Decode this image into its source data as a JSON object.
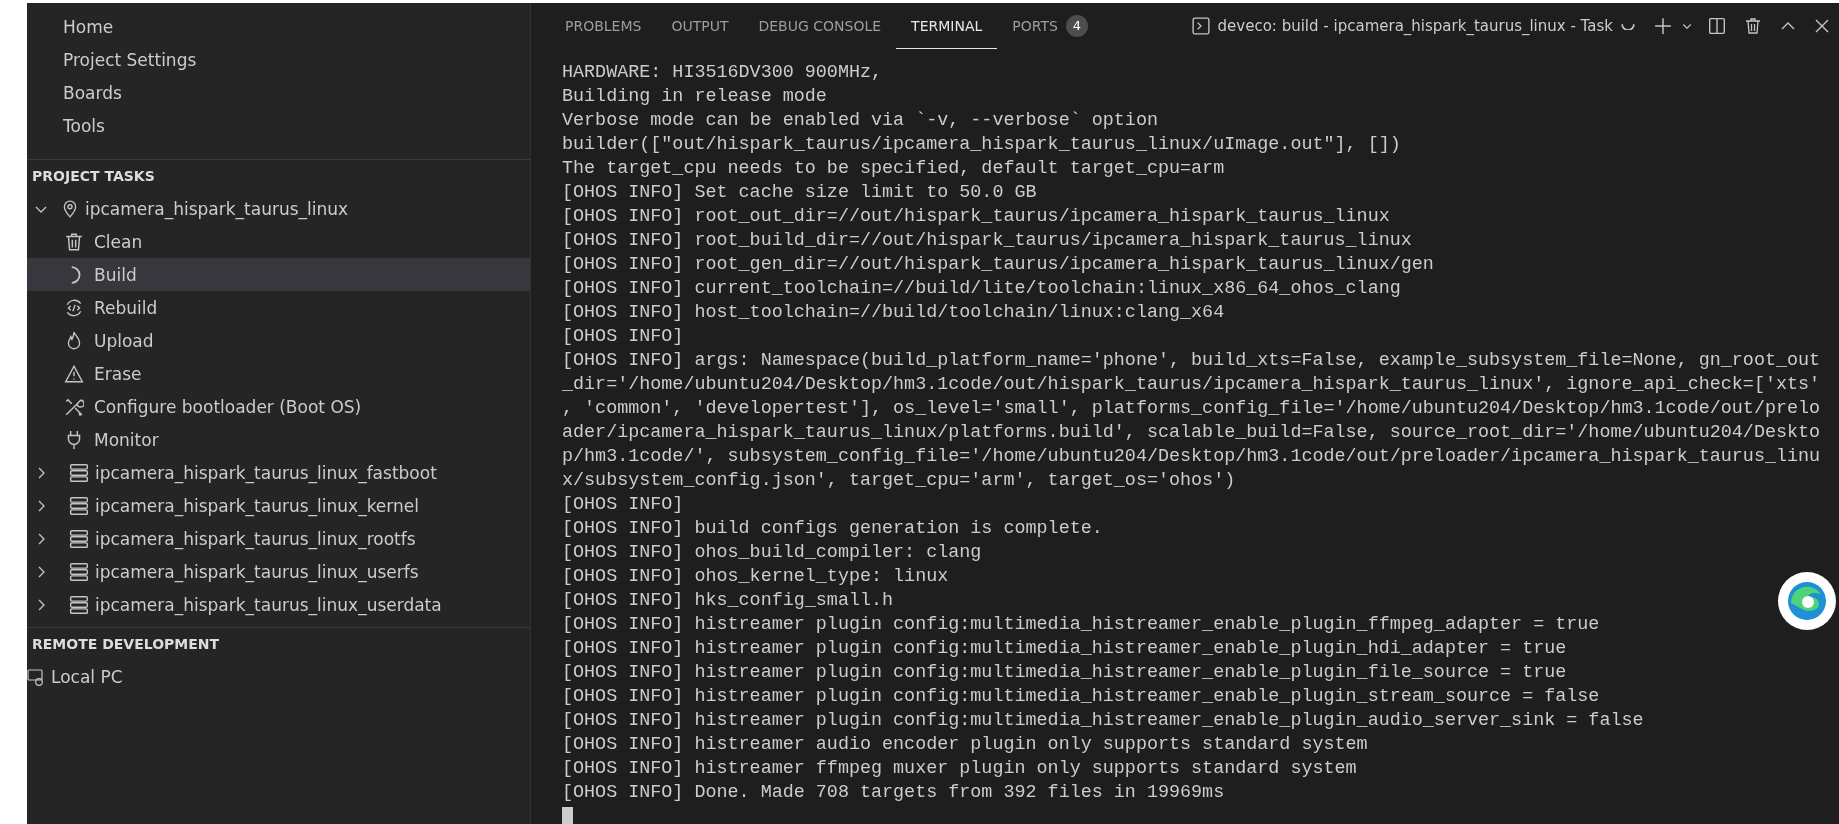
{
  "sidebar": {
    "nav_items": [
      {
        "label": "Home"
      },
      {
        "label": "Project Settings"
      },
      {
        "label": "Boards"
      },
      {
        "label": "Tools"
      }
    ],
    "project_tasks": {
      "title": "PROJECT TASKS",
      "tree": [
        {
          "label": "ipcamera_hispark_taurus_linux",
          "kind": "target",
          "expanded": true,
          "selected": false,
          "children": [
            {
              "label": "Clean",
              "kind": "trash",
              "selected": false
            },
            {
              "label": "Build",
              "kind": "spinner",
              "selected": true
            },
            {
              "label": "Rebuild",
              "kind": "rebuild",
              "selected": false
            },
            {
              "label": "Upload",
              "kind": "flame",
              "selected": false
            },
            {
              "label": "Erase",
              "kind": "warning",
              "selected": false
            },
            {
              "label": "Configure bootloader (Boot OS)",
              "kind": "tools",
              "selected": false
            },
            {
              "label": "Monitor",
              "kind": "plug",
              "selected": false
            }
          ]
        },
        {
          "label": "ipcamera_hispark_taurus_linux_fastboot",
          "kind": "component",
          "expanded": false,
          "selected": false
        },
        {
          "label": "ipcamera_hispark_taurus_linux_kernel",
          "kind": "component",
          "expanded": false,
          "selected": false
        },
        {
          "label": "ipcamera_hispark_taurus_linux_rootfs",
          "kind": "component",
          "expanded": false,
          "selected": false
        },
        {
          "label": "ipcamera_hispark_taurus_linux_userfs",
          "kind": "component",
          "expanded": false,
          "selected": false
        },
        {
          "label": "ipcamera_hispark_taurus_linux_userdata",
          "kind": "component",
          "expanded": false,
          "selected": false
        }
      ]
    },
    "remote": {
      "title": "REMOTE DEVELOPMENT",
      "items": [
        {
          "label": "Local PC"
        }
      ]
    }
  },
  "panel": {
    "tabs": [
      {
        "label": "PROBLEMS",
        "selected": false
      },
      {
        "label": "OUTPUT",
        "selected": false
      },
      {
        "label": "DEBUG CONSOLE",
        "selected": false
      },
      {
        "label": "TERMINAL",
        "selected": true
      },
      {
        "label": "PORTS",
        "selected": false,
        "badge": "4"
      }
    ],
    "task": {
      "label": "deveco: build - ipcamera_hispark_taurus_linux - Task"
    },
    "terminal": {
      "lines": [
        "HARDWARE: HI3516DV300 900MHz,",
        "Building in release mode",
        "Verbose mode can be enabled via `-v, --verbose` option",
        "builder([\"out/hispark_taurus/ipcamera_hispark_taurus_linux/uImage.out\"], [])",
        "The target_cpu needs to be specified, default target_cpu=arm",
        "[OHOS INFO] Set cache size limit to 50.0 GB",
        "[OHOS INFO] root_out_dir=//out/hispark_taurus/ipcamera_hispark_taurus_linux",
        "[OHOS INFO] root_build_dir=//out/hispark_taurus/ipcamera_hispark_taurus_linux",
        "[OHOS INFO] root_gen_dir=//out/hispark_taurus/ipcamera_hispark_taurus_linux/gen",
        "[OHOS INFO] current_toolchain=//build/lite/toolchain:linux_x86_64_ohos_clang",
        "[OHOS INFO] host_toolchain=//build/toolchain/linux:clang_x64",
        "[OHOS INFO]",
        "[OHOS INFO] args: Namespace(build_platform_name='phone', build_xts=False, example_subsystem_file=None, gn_root_out",
        "_dir='/home/ubuntu204/Desktop/hm3.1code/out/hispark_taurus/ipcamera_hispark_taurus_linux', ignore_api_check=['xts'",
        ", 'common', 'developertest'], os_level='small', platforms_config_file='/home/ubuntu204/Desktop/hm3.1code/out/prelo",
        "ader/ipcamera_hispark_taurus_linux/platforms.build', scalable_build=False, source_root_dir='/home/ubuntu204/Deskto",
        "p/hm3.1code/', subsystem_config_file='/home/ubuntu204/Desktop/hm3.1code/out/preloader/ipcamera_hispark_taurus_linu",
        "x/subsystem_config.json', target_cpu='arm', target_os='ohos')",
        "[OHOS INFO]",
        "[OHOS INFO] build configs generation is complete.",
        "[OHOS INFO] ohos_build_compiler: clang",
        "[OHOS INFO] ohos_kernel_type: linux",
        "[OHOS INFO] hks_config_small.h",
        "[OHOS INFO] histreamer plugin config:multimedia_histreamer_enable_plugin_ffmpeg_adapter = true",
        "[OHOS INFO] histreamer plugin config:multimedia_histreamer_enable_plugin_hdi_adapter = true",
        "[OHOS INFO] histreamer plugin config:multimedia_histreamer_enable_plugin_file_source = true",
        "[OHOS INFO] histreamer plugin config:multimedia_histreamer_enable_plugin_stream_source = false",
        "[OHOS INFO] histreamer plugin config:multimedia_histreamer_enable_plugin_audio_server_sink = false",
        "[OHOS INFO] histreamer audio encoder plugin only supports standard system",
        "[OHOS INFO] histreamer ffmpeg muxer plugin only supports standard system",
        "[OHOS INFO] Done. Made 708 targets from 392 files in 19969ms"
      ]
    }
  }
}
